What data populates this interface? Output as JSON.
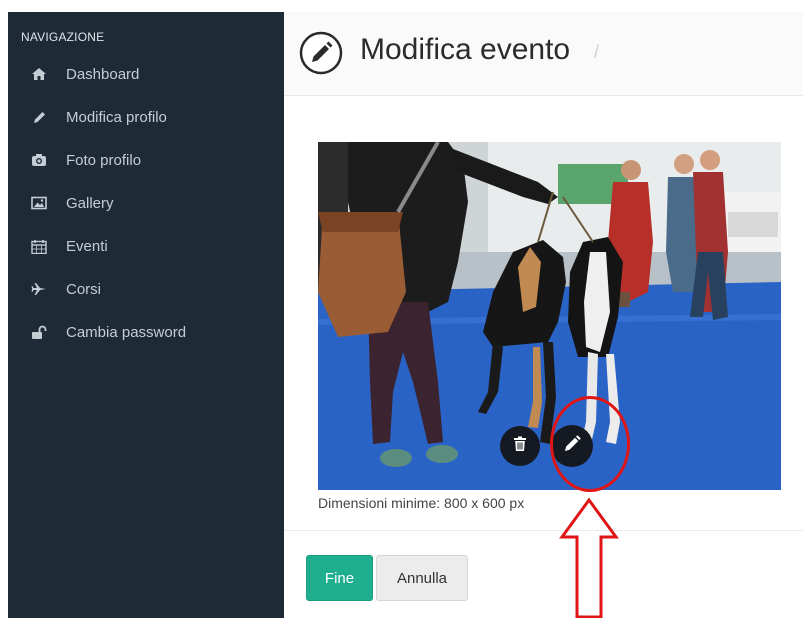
{
  "sidebar": {
    "heading": "NAVIGAZIONE",
    "items": [
      {
        "label": "Dashboard",
        "icon": "home-icon"
      },
      {
        "label": "Modifica profilo",
        "icon": "pencil-icon"
      },
      {
        "label": "Foto profilo",
        "icon": "camera-icon"
      },
      {
        "label": "Gallery",
        "icon": "image-icon"
      },
      {
        "label": "Eventi",
        "icon": "calendar-icon"
      },
      {
        "label": "Corsi",
        "icon": "plane-icon"
      },
      {
        "label": "Cambia password",
        "icon": "unlock-icon"
      }
    ]
  },
  "header": {
    "title": "Modifica evento",
    "icon": "edit-circle-icon",
    "separator": "/"
  },
  "photo": {
    "caption": "Dimensioni minime: 800 x 600 px",
    "delete_icon": "trash-icon",
    "edit_icon": "pencil-icon"
  },
  "actions": {
    "done_label": "Fine",
    "cancel_label": "Annulla"
  },
  "colors": {
    "sidebar_bg": "#1f2a37",
    "primary_button": "#1fae8e",
    "annotation": "#e01616"
  }
}
